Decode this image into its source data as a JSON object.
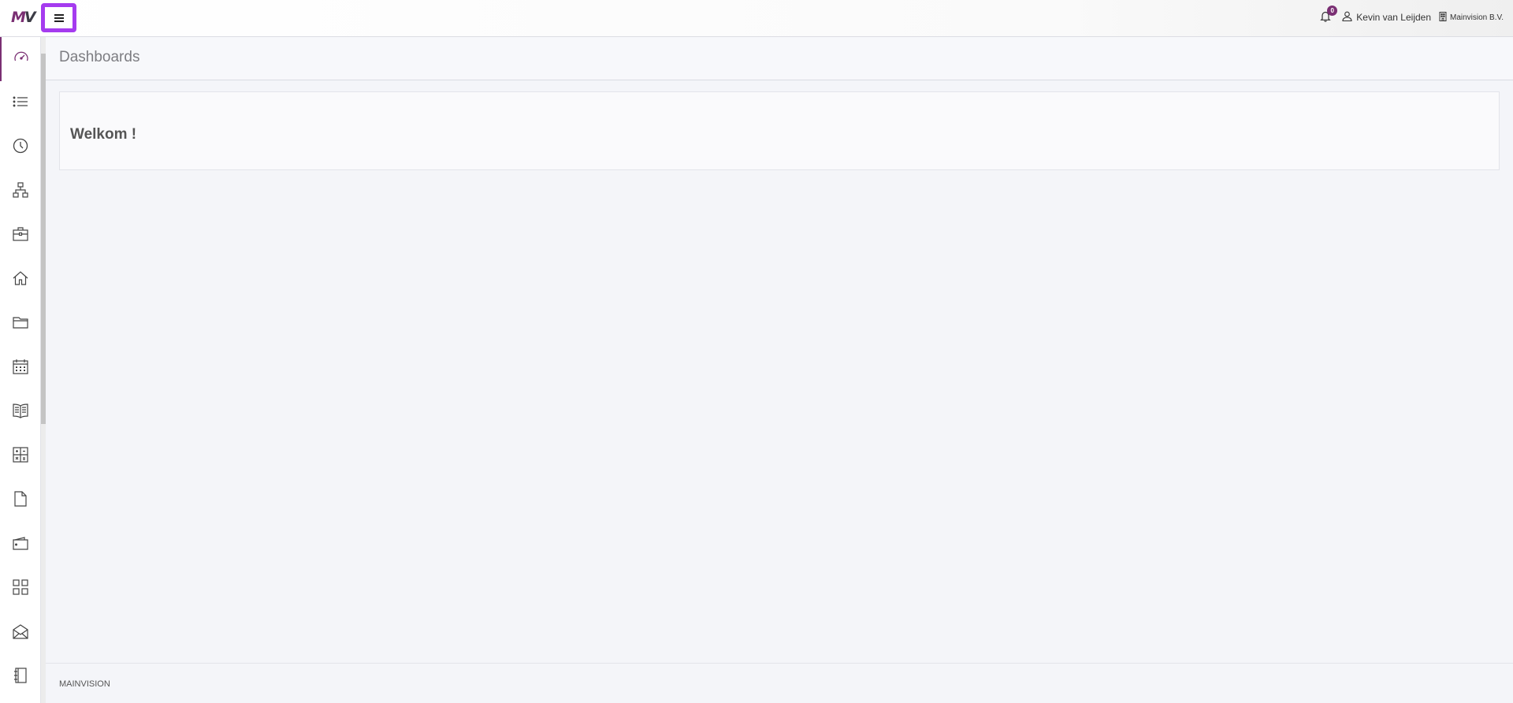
{
  "app": {
    "logo_text_m": "M",
    "logo_text_v": "V",
    "accent_color": "#7a2f73",
    "highlight_color": "#a53bef"
  },
  "header": {
    "menu_icon": "hamburger-icon",
    "notifications": {
      "icon": "bell-icon",
      "count": "0"
    },
    "user": {
      "icon": "user-icon",
      "name": "Kevin van Leijden"
    },
    "company": {
      "icon": "building-icon",
      "name": "Mainvision B.V."
    }
  },
  "sidebar": {
    "items": [
      {
        "icon": "dashboard-gauge-icon",
        "active": true
      },
      {
        "icon": "list-icon"
      },
      {
        "icon": "clock-icon"
      },
      {
        "icon": "hierarchy-icon"
      },
      {
        "icon": "briefcase-icon"
      },
      {
        "icon": "home-icon"
      },
      {
        "icon": "folder-icon"
      },
      {
        "icon": "calendar-icon"
      },
      {
        "icon": "book-icon"
      },
      {
        "icon": "calculator-icon"
      },
      {
        "icon": "document-icon"
      },
      {
        "icon": "wallet-icon"
      },
      {
        "icon": "grid-icon"
      },
      {
        "icon": "envelope-open-icon"
      },
      {
        "icon": "notebook-icon"
      }
    ]
  },
  "main": {
    "page_title": "Dashboards",
    "welcome": "Welkom !"
  },
  "footer": {
    "text": "MAINVISION"
  }
}
